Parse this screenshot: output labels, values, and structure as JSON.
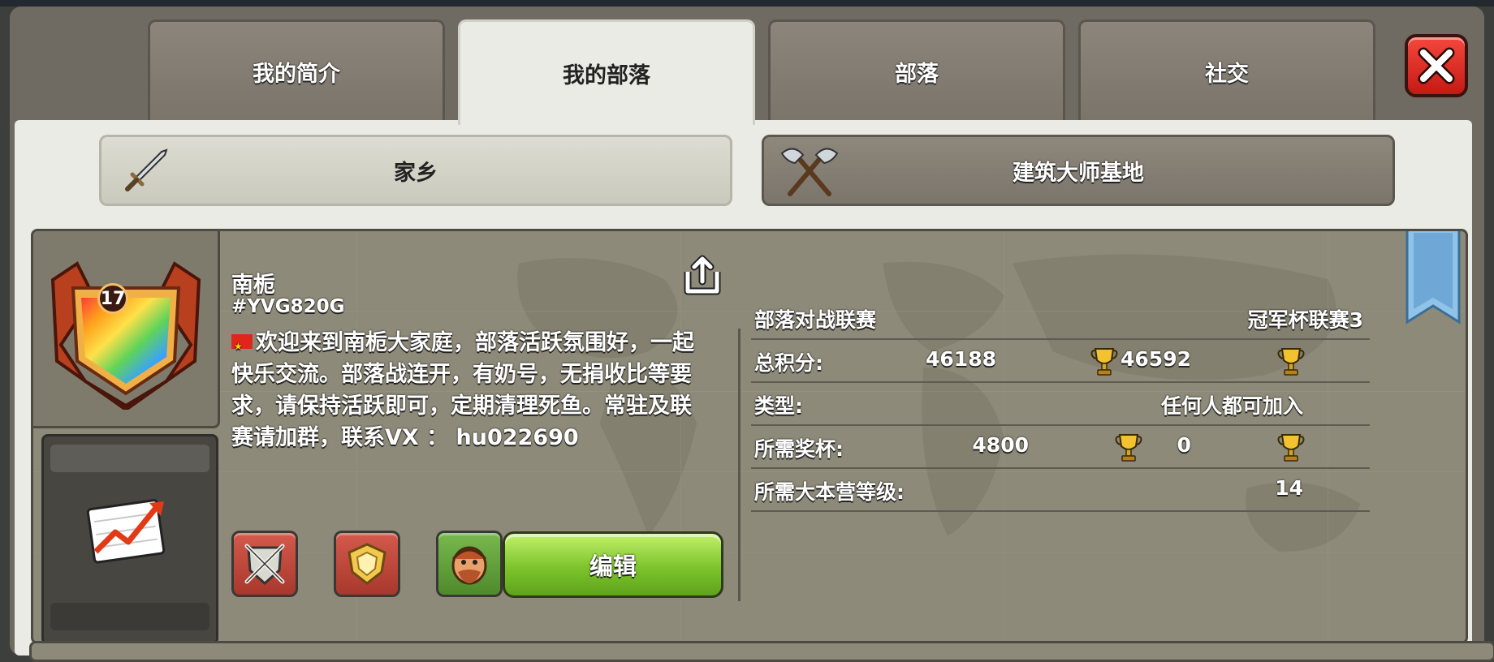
{
  "tabs": [
    {
      "label": "我的简介"
    },
    {
      "label": "我的部落"
    },
    {
      "label": "部落"
    },
    {
      "label": "社交"
    }
  ],
  "subtabs": {
    "home": "家乡",
    "builder": "建筑大师基地"
  },
  "clan": {
    "level": "17",
    "name": "南栀",
    "tag": "#YVG820G",
    "description": "欢迎来到南栀大家庭，部落活跃氛围好，一起快乐交流。部落战连开，有奶号，无捐收比等要求，请保持活跃即可，定期清理死鱼。常驻及联赛请加群，联系VX ： hu022690",
    "edit_label": "编辑"
  },
  "info": {
    "war_league": {
      "label": "部落对战联赛",
      "value": "冠军杯联赛3"
    },
    "total_points": {
      "label": "总积分:",
      "value1": "46188",
      "value2": "46592"
    },
    "type": {
      "label": "类型:",
      "value": "任何人都可加入"
    },
    "required_trophies": {
      "label": "所需奖杯:",
      "value1": "4800",
      "value2": "0"
    },
    "required_th": {
      "label": "所需大本营等级:",
      "value": "14"
    }
  },
  "icons": {
    "close": "close-icon",
    "share": "share-icon",
    "sword": "sword-icon",
    "axes": "crossed-axes-icon",
    "trophy": "trophy-icon",
    "stats": "stats-chart-icon",
    "war_shield": "war-shield-icon",
    "league_badge": "league-badge-icon",
    "builder_face": "builder-icon"
  },
  "colors": {
    "tab_active": "#ebebe6",
    "edit_button": "#7cc42c",
    "close_button": "#e02f24"
  }
}
